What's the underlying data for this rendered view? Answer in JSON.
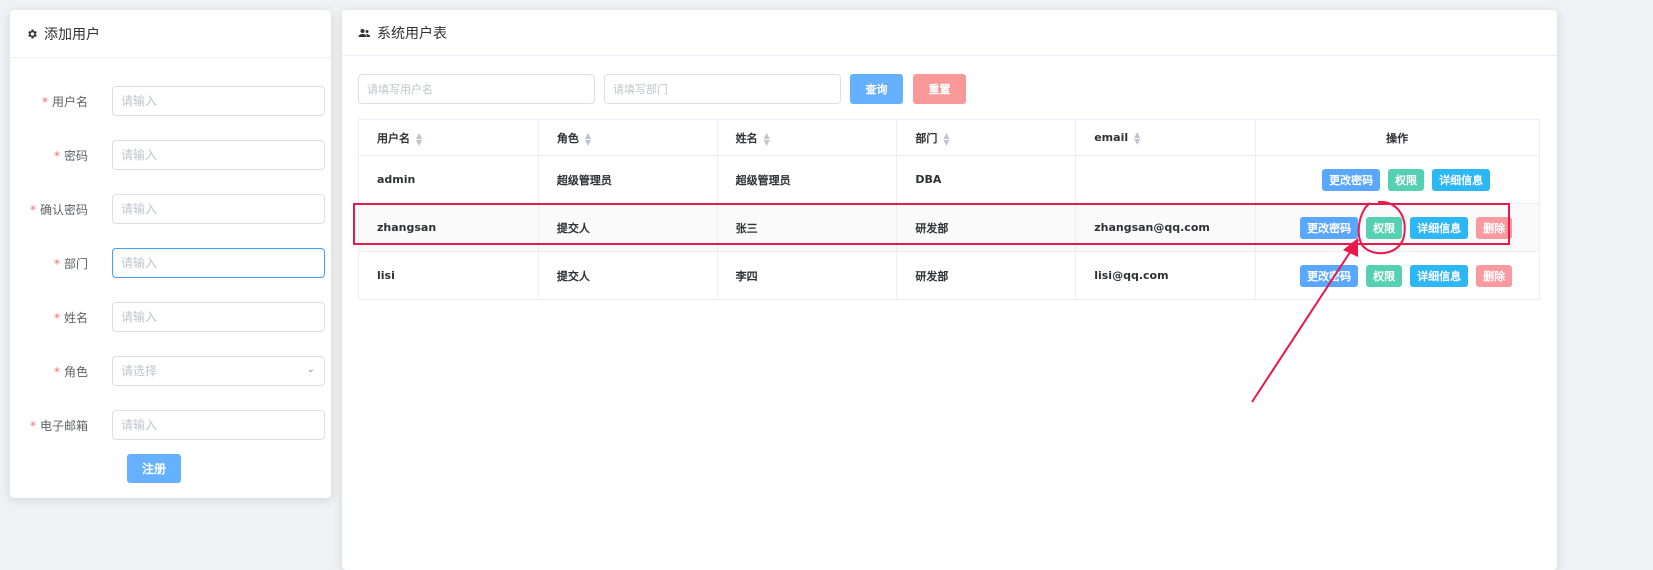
{
  "left_panel": {
    "title": "添加用户",
    "icon": "gear-icon",
    "fields": [
      {
        "label": "用户名",
        "placeholder": "请输入",
        "value": ""
      },
      {
        "label": "密码",
        "placeholder": "请输入",
        "value": ""
      },
      {
        "label": "确认密码",
        "placeholder": "请输入",
        "value": ""
      },
      {
        "label": "部门",
        "placeholder": "请输入",
        "value": ""
      },
      {
        "label": "姓名",
        "placeholder": "请输入",
        "value": ""
      },
      {
        "label": "角色",
        "placeholder": "请选择",
        "value": ""
      },
      {
        "label": "电子邮箱",
        "placeholder": "请输入",
        "value": ""
      }
    ],
    "required_mark": "*",
    "submit_label": "注册"
  },
  "right_panel": {
    "title": "系统用户表",
    "icon": "users-icon",
    "search": {
      "username_placeholder": "请填写用户名",
      "dept_placeholder": "请填写部门",
      "query_label": "查询",
      "reset_label": "重置"
    },
    "table": {
      "columns": [
        "用户名",
        "角色",
        "姓名",
        "部门",
        "email",
        "操作"
      ],
      "rows": [
        {
          "username": "admin",
          "role": "超级管理员",
          "name": "超级管理员",
          "dept": "DBA",
          "email": "",
          "actions": [
            "更改密码",
            "权限",
            "详细信息"
          ]
        },
        {
          "username": "zhangsan",
          "role": "提交人",
          "name": "张三",
          "dept": "研发部",
          "email": "zhangsan@qq.com",
          "actions": [
            "更改密码",
            "权限",
            "详细信息",
            "删除"
          ]
        },
        {
          "username": "lisi",
          "role": "提交人",
          "name": "李四",
          "dept": "研发部",
          "email": "lisi@qq.com",
          "actions": [
            "更改密码",
            "权限",
            "详细信息",
            "删除"
          ]
        }
      ]
    }
  },
  "colors": {
    "accent": "#409eff",
    "annotation": "#e8194a"
  }
}
